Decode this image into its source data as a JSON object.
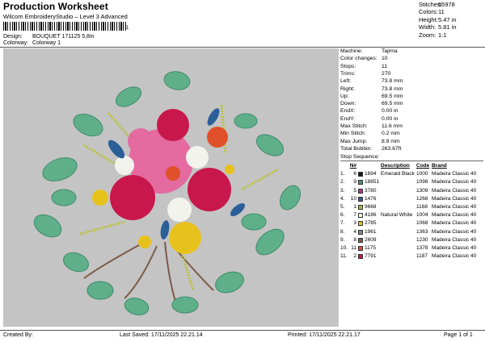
{
  "header": {
    "title": "Production Worksheet",
    "subtitle": "Wilcom EmbroideryStudio – Level 3 Advanced",
    "barcode_tail": "1",
    "design_label": "Design:",
    "design_value": "BOUQUET 171125 5,8in",
    "colorway_label": "Colorway:",
    "colorway_value": "Colorway 1"
  },
  "stats": [
    {
      "label": "Stitches:",
      "value": "55978"
    },
    {
      "label": "Colors:",
      "value": "11"
    },
    {
      "label": "Height:",
      "value": "5.47 in"
    },
    {
      "label": "Width:",
      "value": "5.81 in"
    },
    {
      "label": "Zoom:",
      "value": "1:1"
    }
  ],
  "info": [
    {
      "label": "Machine:",
      "value": "Tajima"
    },
    {
      "label": "Color changes:",
      "value": "10"
    },
    {
      "label": "Stops:",
      "value": "11"
    },
    {
      "label": "Trims:",
      "value": "270"
    },
    {
      "label": "Left:",
      "value": "73.8 mm"
    },
    {
      "label": "Right:",
      "value": "73.8 mm"
    },
    {
      "label": "Up:",
      "value": "69.5 mm"
    },
    {
      "label": "Down:",
      "value": "69.5 mm"
    },
    {
      "label": "EndX:",
      "value": "0.00 in"
    },
    {
      "label": "EndY:",
      "value": "0.00 in"
    },
    {
      "label": "Max Stitch:",
      "value": "11.6 mm"
    },
    {
      "label": "Min Stitch:",
      "value": "0.2 mm"
    },
    {
      "label": "Max Jump:",
      "value": "8.9 mm"
    },
    {
      "label": "Total Bobbin:",
      "value": "263.67ft"
    }
  ],
  "stop_sequence": {
    "title": "Stop Sequence:",
    "headers": {
      "n": "N#",
      "desc": "Description",
      "code": "Code",
      "brand": "Brand"
    },
    "rows": [
      {
        "stop": "1.",
        "n": "6",
        "color": "#1a1a1a",
        "num": "1694",
        "desc": "Emerald Black",
        "code": "1000",
        "brand": "Madeira Classic 40"
      },
      {
        "stop": "2.",
        "n": "9",
        "color": "#4f8f80",
        "num": "18851",
        "desc": "",
        "code": "1098",
        "brand": "Madeira Classic 40"
      },
      {
        "stop": "3.",
        "n": "5",
        "color": "#b0308f",
        "num": "3780",
        "desc": "",
        "code": "1309",
        "brand": "Madeira Classic 40"
      },
      {
        "stop": "4.",
        "n": "10",
        "color": "#2b5f98",
        "num": "1476",
        "desc": "",
        "code": "1266",
        "brand": "Madeira Classic 40"
      },
      {
        "stop": "5.",
        "n": "1",
        "color": "#a7b53a",
        "num": "9668",
        "desc": "",
        "code": "1168",
        "brand": "Madeira Classic 40"
      },
      {
        "stop": "6.",
        "n": "7",
        "color": "#f3f3ee",
        "num": "4186",
        "desc": "Natural White",
        "code": "1004",
        "brand": "Madeira Classic 40"
      },
      {
        "stop": "7.",
        "n": "3",
        "color": "#e8c21c",
        "num": "2785",
        "desc": "",
        "code": "1068",
        "brand": "Madeira Classic 40"
      },
      {
        "stop": "8.",
        "n": "4",
        "color": "#808c8c",
        "num": "1961",
        "desc": "",
        "code": "1363",
        "brand": "Madeira Classic 40"
      },
      {
        "stop": "9.",
        "n": "8",
        "color": "#7c5a48",
        "num": "2609",
        "desc": "",
        "code": "1230",
        "brand": "Madeira Classic 40"
      },
      {
        "stop": "10.",
        "n": "11",
        "color": "#e0502a",
        "num": "1175",
        "desc": "",
        "code": "1378",
        "brand": "Madeira Classic 40"
      },
      {
        "stop": "11.",
        "n": "2",
        "color": "#c8174c",
        "num": "7791",
        "desc": "",
        "code": "1187",
        "brand": "Madeira Classic 40"
      }
    ]
  },
  "footer": {
    "created_by": "Created By:",
    "last_saved": "Last Saved: 17/11/2025 22.21.14",
    "printed": "Printed: 17/11/2025 22.21.17",
    "page": "Page 1 of 1"
  },
  "colors": {
    "canvas_bg": "#c4c4c4",
    "leaf": "#5fb08a",
    "leaf_dark": "#3f8a6a",
    "fern": "#b8c23a",
    "rose": "#c8174c",
    "pink": "#e46aa0",
    "orange": "#e0502a",
    "yellow": "#e8c21c",
    "blue": "#2b5f98",
    "white": "#f3f3ee",
    "stem": "#7c5a48"
  }
}
